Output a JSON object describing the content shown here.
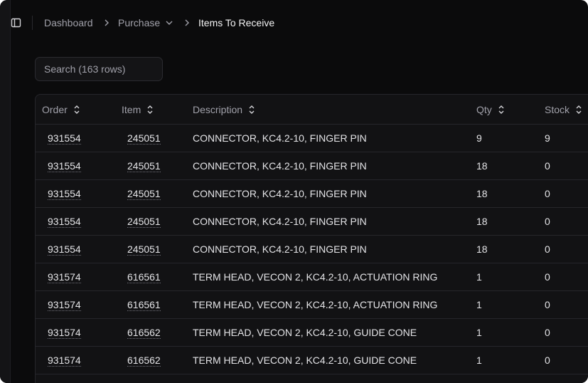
{
  "breadcrumb": {
    "items": [
      "Dashboard",
      "Purchase",
      "Items To Receive"
    ]
  },
  "search": {
    "placeholder": "Search (163 rows)"
  },
  "table": {
    "columns": [
      "Order",
      "Item",
      "Description",
      "Qty",
      "Stock"
    ],
    "rows": [
      {
        "order": "931554",
        "item": "245051",
        "description": "CONNECTOR, KC4.2-10, FINGER PIN",
        "qty": "9",
        "stock": "9"
      },
      {
        "order": "931554",
        "item": "245051",
        "description": "CONNECTOR, KC4.2-10, FINGER PIN",
        "qty": "18",
        "stock": "0"
      },
      {
        "order": "931554",
        "item": "245051",
        "description": "CONNECTOR, KC4.2-10, FINGER PIN",
        "qty": "18",
        "stock": "0"
      },
      {
        "order": "931554",
        "item": "245051",
        "description": "CONNECTOR, KC4.2-10, FINGER PIN",
        "qty": "18",
        "stock": "0"
      },
      {
        "order": "931554",
        "item": "245051",
        "description": "CONNECTOR, KC4.2-10, FINGER PIN",
        "qty": "18",
        "stock": "0"
      },
      {
        "order": "931574",
        "item": "616561",
        "description": "TERM HEAD, VECON 2, KC4.2-10, ACTUATION RING",
        "qty": "1",
        "stock": "0"
      },
      {
        "order": "931574",
        "item": "616561",
        "description": "TERM HEAD, VECON 2, KC4.2-10, ACTUATION RING",
        "qty": "1",
        "stock": "0"
      },
      {
        "order": "931574",
        "item": "616562",
        "description": "TERM HEAD, VECON 2, KC4.2-10, GUIDE CONE",
        "qty": "1",
        "stock": "0"
      },
      {
        "order": "931574",
        "item": "616562",
        "description": "TERM HEAD, VECON 2, KC4.2-10, GUIDE CONE",
        "qty": "1",
        "stock": "0"
      }
    ]
  },
  "icons": {
    "sidebar_toggle": "sidebar-toggle-icon",
    "breadcrumb_separator": "chevron-right-icon",
    "dropdown": "chevron-down-icon",
    "sort": "sort-arrows-icon"
  },
  "colors": {
    "background": "#0b0b0c",
    "surface": "#121214",
    "border": "#26262b",
    "text_primary": "#e4e4e7",
    "text_muted": "#a1a1aa"
  }
}
